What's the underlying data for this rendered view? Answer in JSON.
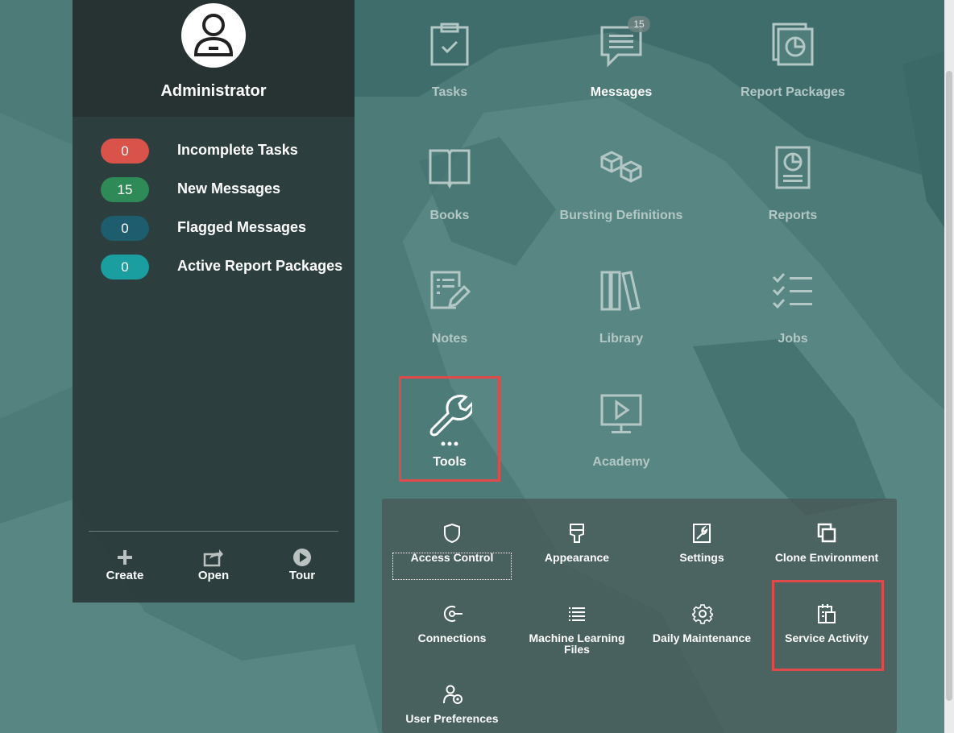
{
  "user": {
    "name": "Administrator"
  },
  "stats": [
    {
      "count": "0",
      "label": "Incomplete Tasks",
      "color": "#d9534a"
    },
    {
      "count": "15",
      "label": "New Messages",
      "color": "#2e8b57"
    },
    {
      "count": "0",
      "label": "Flagged Messages",
      "color": "#1e5d6e"
    },
    {
      "count": "0",
      "label": "Active Report Packages",
      "color": "#1a9ea0"
    }
  ],
  "actions": [
    {
      "label": "Create",
      "icon": "plus-icon"
    },
    {
      "label": "Open",
      "icon": "share-icon"
    },
    {
      "label": "Tour",
      "icon": "play-icon"
    }
  ],
  "tiles": [
    {
      "label": "Tasks",
      "icon": "clipboard-check-icon"
    },
    {
      "label": "Messages",
      "icon": "chat-icon",
      "badge": "15"
    },
    {
      "label": "Report Packages",
      "icon": "report-package-icon"
    },
    {
      "label": "Books",
      "icon": "book-icon"
    },
    {
      "label": "Bursting Definitions",
      "icon": "cubes-icon"
    },
    {
      "label": "Reports",
      "icon": "report-icon"
    },
    {
      "label": "Notes",
      "icon": "note-edit-icon"
    },
    {
      "label": "Library",
      "icon": "library-icon"
    },
    {
      "label": "Jobs",
      "icon": "checklist-icon"
    },
    {
      "label": "Tools",
      "icon": "wrench-icon"
    },
    {
      "label": "Academy",
      "icon": "monitor-play-icon"
    }
  ],
  "tools": [
    {
      "label": "Access Control",
      "icon": "shield-icon"
    },
    {
      "label": "Appearance",
      "icon": "brush-icon"
    },
    {
      "label": "Settings",
      "icon": "settings-wrench-icon"
    },
    {
      "label": "Clone Environment",
      "icon": "clone-icon"
    },
    {
      "label": "Connections",
      "icon": "connection-icon"
    },
    {
      "label": "Machine Learning Files",
      "icon": "list-icon"
    },
    {
      "label": "Daily Maintenance",
      "icon": "gear-icon"
    },
    {
      "label": "Service Activity",
      "icon": "calendar-clipboard-icon"
    },
    {
      "label": "User Preferences",
      "icon": "user-gear-icon"
    }
  ],
  "colors": {
    "highlight": "#e04a4a",
    "background": "#4f7d7a"
  }
}
